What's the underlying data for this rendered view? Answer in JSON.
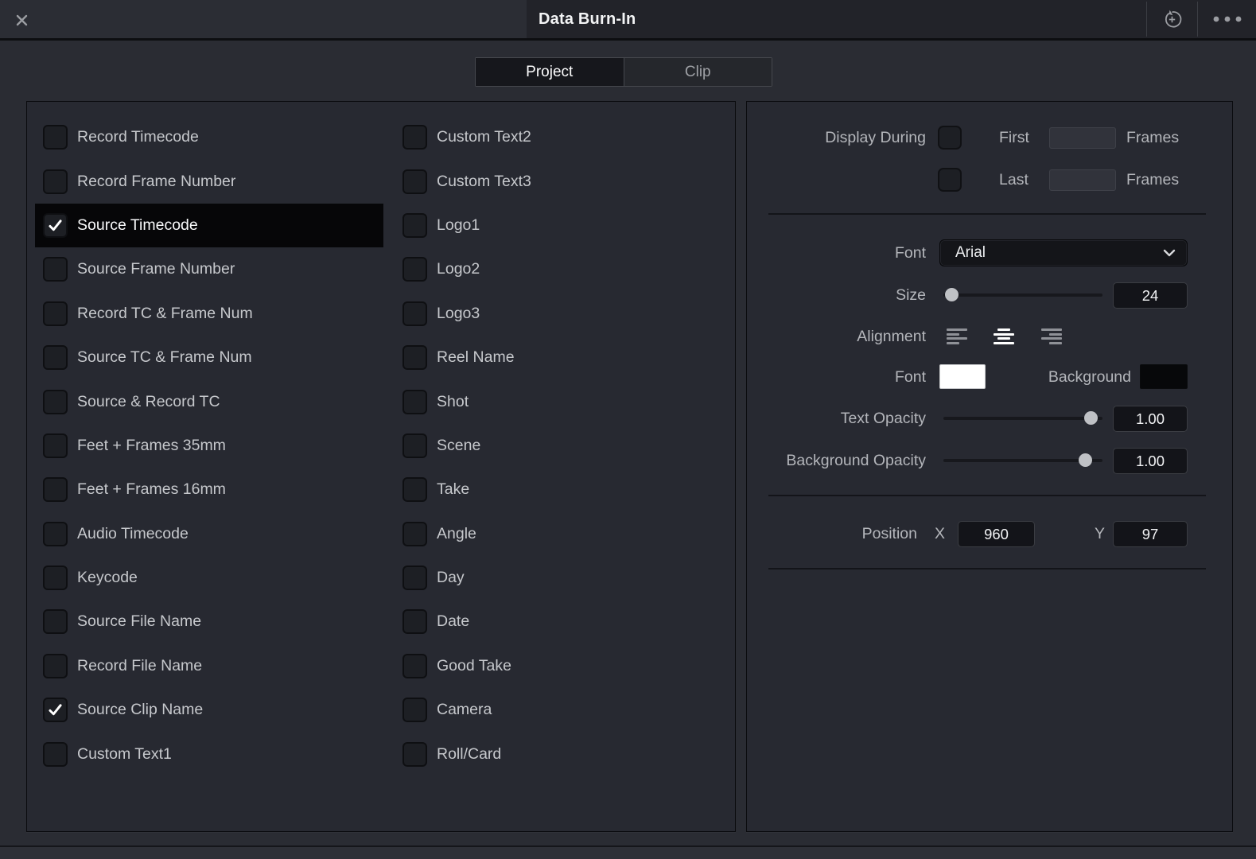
{
  "titlebar": {
    "title": "Data Burn-In"
  },
  "tabs": {
    "project": "Project",
    "clip": "Clip"
  },
  "checklist": {
    "columns": [
      {
        "items": [
          {
            "label": "Record Timecode",
            "checked": false,
            "selected": false
          },
          {
            "label": "Record Frame Number",
            "checked": false,
            "selected": false
          },
          {
            "label": "Source Timecode",
            "checked": true,
            "selected": true
          },
          {
            "label": "Source Frame Number",
            "checked": false,
            "selected": false
          },
          {
            "label": "Record TC & Frame Num",
            "checked": false,
            "selected": false
          },
          {
            "label": "Source TC & Frame Num",
            "checked": false,
            "selected": false
          },
          {
            "label": "Source & Record TC",
            "checked": false,
            "selected": false
          },
          {
            "label": "Feet + Frames 35mm",
            "checked": false,
            "selected": false
          },
          {
            "label": "Feet + Frames 16mm",
            "checked": false,
            "selected": false
          },
          {
            "label": "Audio Timecode",
            "checked": false,
            "selected": false
          },
          {
            "label": "Keycode",
            "checked": false,
            "selected": false
          },
          {
            "label": "Source File Name",
            "checked": false,
            "selected": false
          },
          {
            "label": "Record File Name",
            "checked": false,
            "selected": false
          },
          {
            "label": "Source Clip Name",
            "checked": true,
            "selected": false
          },
          {
            "label": "Custom Text1",
            "checked": false,
            "selected": false
          }
        ]
      },
      {
        "items": [
          {
            "label": "Custom Text2",
            "checked": false,
            "selected": false
          },
          {
            "label": "Custom Text3",
            "checked": false,
            "selected": false
          },
          {
            "label": "Logo1",
            "checked": false,
            "selected": false
          },
          {
            "label": "Logo2",
            "checked": false,
            "selected": false
          },
          {
            "label": "Logo3",
            "checked": false,
            "selected": false
          },
          {
            "label": "Reel Name",
            "checked": false,
            "selected": false
          },
          {
            "label": "Shot",
            "checked": false,
            "selected": false
          },
          {
            "label": "Scene",
            "checked": false,
            "selected": false
          },
          {
            "label": "Take",
            "checked": false,
            "selected": false
          },
          {
            "label": "Angle",
            "checked": false,
            "selected": false
          },
          {
            "label": "Day",
            "checked": false,
            "selected": false
          },
          {
            "label": "Date",
            "checked": false,
            "selected": false
          },
          {
            "label": "Good Take",
            "checked": false,
            "selected": false
          },
          {
            "label": "Camera",
            "checked": false,
            "selected": false
          },
          {
            "label": "Roll/Card",
            "checked": false,
            "selected": false
          }
        ]
      }
    ]
  },
  "settings": {
    "display_during_label": "Display During",
    "first_label": "First",
    "last_label": "Last",
    "frames_label": "Frames",
    "first_value": "",
    "last_value": "",
    "font_label": "Font",
    "font_value": "Arial",
    "size_label": "Size",
    "size_value": "24",
    "alignment_label": "Alignment",
    "font_color_label": "Font",
    "font_color": "#ffffff",
    "background_color_label": "Background",
    "background_color": "#07080a",
    "text_opacity_label": "Text Opacity",
    "text_opacity_value": "1.00",
    "background_opacity_label": "Background Opacity",
    "background_opacity_value": "1.00",
    "position_label": "Position",
    "x_label": "X",
    "x_value": "960",
    "y_label": "Y",
    "y_value": "97"
  }
}
